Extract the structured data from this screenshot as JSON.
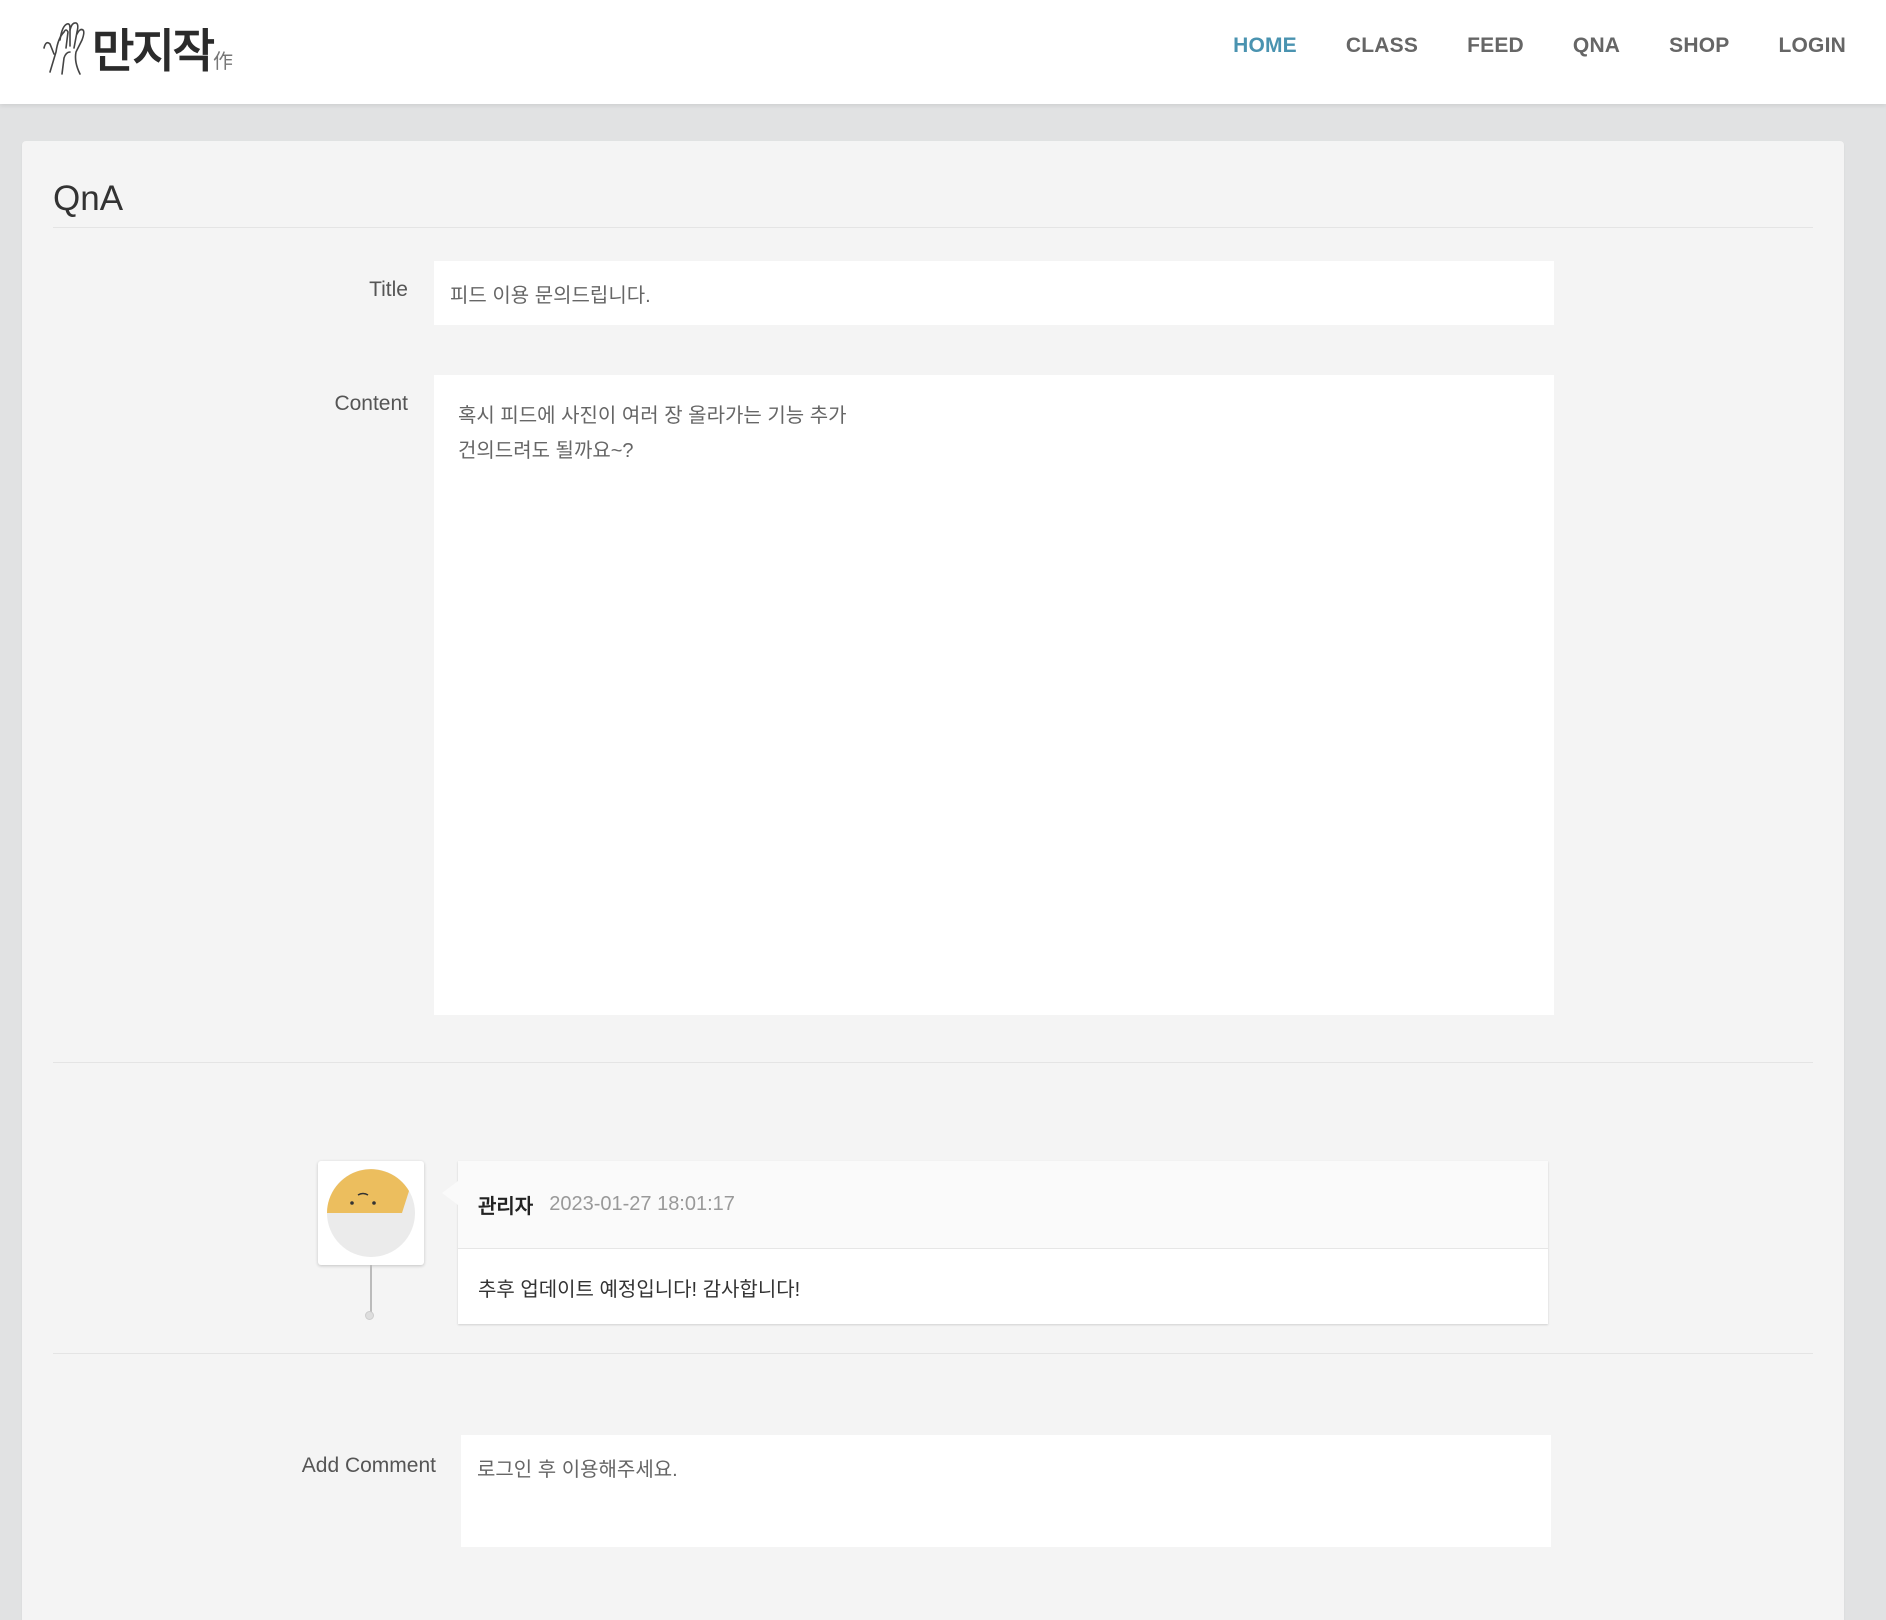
{
  "header": {
    "logo_text": "만지작",
    "logo_sub": "作",
    "nav": [
      {
        "label": "HOME",
        "active": true
      },
      {
        "label": "CLASS",
        "active": false
      },
      {
        "label": "FEED",
        "active": false
      },
      {
        "label": "QNA",
        "active": false
      },
      {
        "label": "SHOP",
        "active": false
      },
      {
        "label": "LOGIN",
        "active": false
      }
    ]
  },
  "page": {
    "title": "QnA",
    "title_label": "Title",
    "title_value": "피드 이용 문의드립니다.",
    "content_label": "Content",
    "content_value": "혹시 피드에 사진이 여러 장 올라가는 기능 추가\n건의드려도 될까요~?"
  },
  "comments": [
    {
      "author": "관리자",
      "date": "2023-01-27 18:01:17",
      "text": "추후 업데이트 예정입니다! 감사합니다!",
      "avatar": "sleepy-face-icon"
    }
  ],
  "add_comment": {
    "label": "Add Comment",
    "placeholder": "로그인 후 이용해주세요."
  },
  "colors": {
    "accent": "#4a93b0",
    "background": "#e1e2e3",
    "panel": "#f4f4f4",
    "avatar_yellow": "#ecbe5e"
  }
}
